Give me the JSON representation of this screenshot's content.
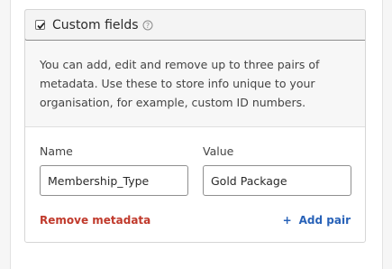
{
  "custom_fields": {
    "title": "Custom fields",
    "checked": true,
    "description": "You can add, edit and remove up to three pairs of metadata. Use these to store info unique to your organisation, for example, custom ID numbers.",
    "name_label": "Name",
    "value_label": "Value",
    "name_value": "Membership_Type",
    "value_value": "Gold Package",
    "remove_label": "Remove metadata",
    "add_icon": "+",
    "add_label": "Add pair"
  },
  "colors": {
    "remove": "#c0392b",
    "add": "#2862b8"
  },
  "icons": {
    "help": "help-circle-icon",
    "checkbox": "checkmark-icon"
  }
}
